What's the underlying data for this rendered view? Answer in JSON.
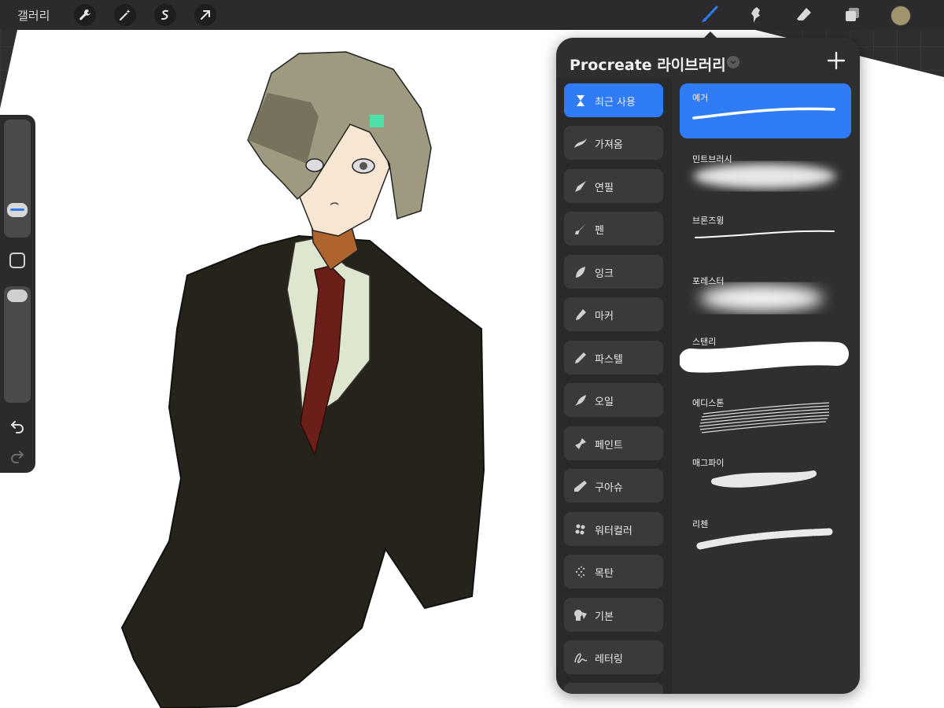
{
  "topbar": {
    "gallery_label": "갤러리",
    "left_tools": [
      "wrench-icon",
      "magic-wand-icon",
      "selection-icon",
      "transform-arrow-icon"
    ],
    "right_tools": [
      "brush-icon",
      "smudge-icon",
      "eraser-icon",
      "layers-icon"
    ],
    "current_color": "#9f946a"
  },
  "panel": {
    "title": "Procreate 라이브러리",
    "add_icon": "plus-icon",
    "accent": "#2f7cf6",
    "categories": [
      {
        "label": "최근 사용",
        "icon": "hourglass-icon"
      },
      {
        "label": "가져옴",
        "icon": "stroke-icon"
      },
      {
        "label": "연필",
        "icon": "pencil-icon"
      },
      {
        "label": "펜",
        "icon": "pen-icon"
      },
      {
        "label": "잉크",
        "icon": "ink-drop-icon"
      },
      {
        "label": "마커",
        "icon": "marker-icon"
      },
      {
        "label": "파스텔",
        "icon": "pastel-icon"
      },
      {
        "label": "오일",
        "icon": "oil-icon"
      },
      {
        "label": "페인트",
        "icon": "paint-icon"
      },
      {
        "label": "구아슈",
        "icon": "gouache-icon"
      },
      {
        "label": "워터컬러",
        "icon": "watercolor-icon"
      },
      {
        "label": "목탄",
        "icon": "charcoal-icon"
      },
      {
        "label": "기본",
        "icon": "shapes-icon"
      },
      {
        "label": "레터링",
        "icon": "lettering-icon"
      }
    ],
    "brushes": [
      {
        "name": "예거"
      },
      {
        "name": "민트브러시"
      },
      {
        "name": "브론즈윙"
      },
      {
        "name": "포레스터"
      },
      {
        "name": "스탠리"
      },
      {
        "name": "에디스톤"
      },
      {
        "name": "매그파이"
      },
      {
        "name": "리첸"
      }
    ]
  },
  "sidebar": {
    "square_icon": "modify-square-icon",
    "undo_icon": "undo-icon",
    "redo_icon": "redo-icon"
  }
}
